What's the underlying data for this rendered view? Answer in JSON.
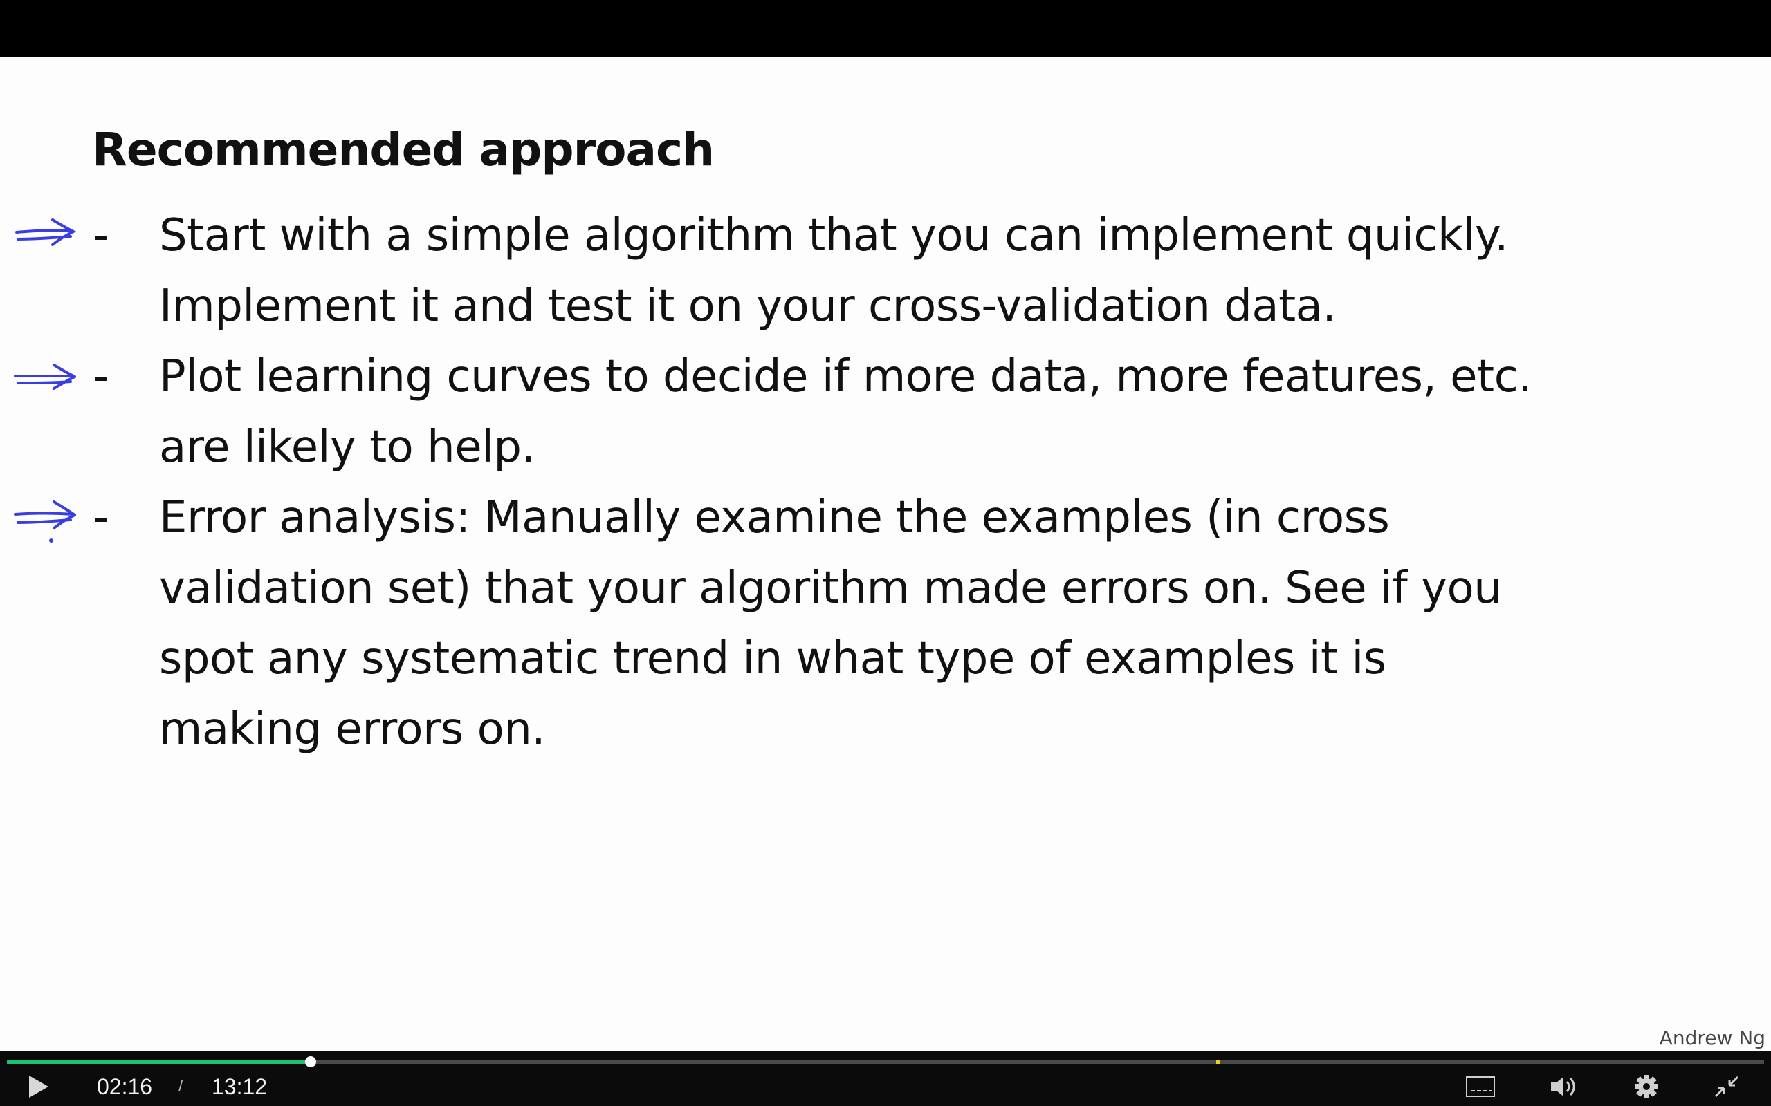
{
  "slide": {
    "title": "Recommended approach",
    "bullets": [
      {
        "lines": [
          "Start with a simple algorithm that you can implement quickly.",
          "Implement it and test it on your cross-validation data."
        ]
      },
      {
        "lines": [
          "Plot learning curves to decide if more data, more features, etc.",
          "are likely to help."
        ]
      },
      {
        "lines": [
          "Error analysis:  Manually examine the examples (in cross",
          "validation set) that your algorithm made errors on. See if you",
          "spot any systematic trend in what type of examples it is",
          "making errors on."
        ]
      }
    ],
    "dash": "-",
    "annotation_color": "#3a3ee0",
    "credit": "Andrew Ng"
  },
  "player": {
    "current_time": "02:16",
    "separator": "/",
    "duration": "13:12",
    "progress_fraction": 0.1728,
    "marker_fraction": 0.688,
    "accent_color": "#1dbf73",
    "icons": [
      "play-icon",
      "captions-icon",
      "volume-icon",
      "settings-icon",
      "exit-fullscreen-icon"
    ]
  }
}
